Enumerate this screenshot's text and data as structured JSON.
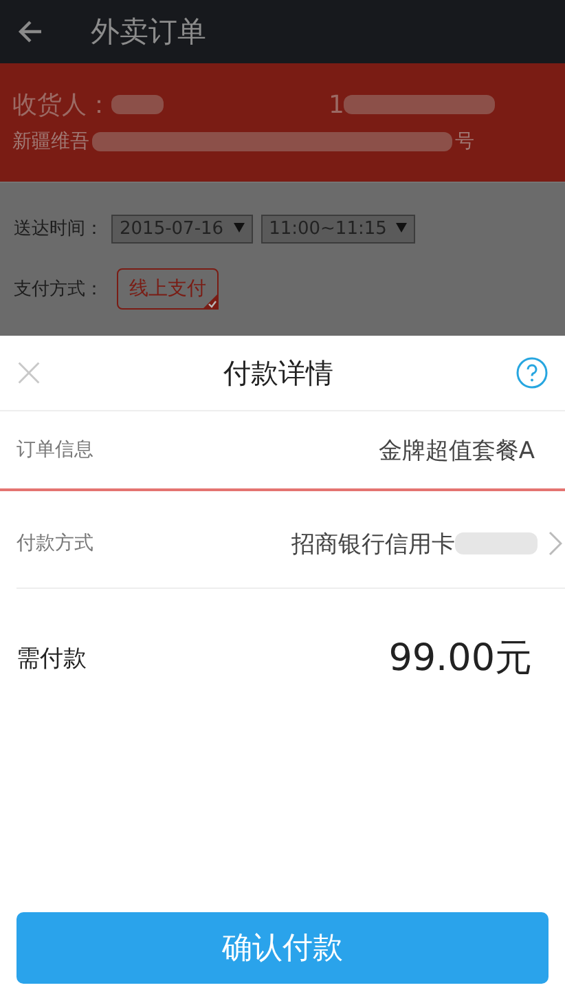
{
  "header": {
    "title": "外卖订单"
  },
  "receiver": {
    "label": "收货人：",
    "phone": "1",
    "address_start": "新疆维吾",
    "address_end": "号"
  },
  "delivery": {
    "label": "送达时间：",
    "date": "2015-07-16",
    "time": "11:00~11:15"
  },
  "payment": {
    "label": "支付方式：",
    "options": [
      {
        "label": "线上支付",
        "selected": true
      }
    ]
  },
  "sheet": {
    "title": "付款详情",
    "rows": [
      {
        "label": "订单信息",
        "value": "金牌超值套餐A",
        "kind": "plain"
      },
      {
        "label": "付款方式",
        "value": "招商银行信用卡",
        "kind": "link"
      }
    ],
    "amount_label": "需付款",
    "amount": "99.00元",
    "confirm": "确认付款"
  }
}
